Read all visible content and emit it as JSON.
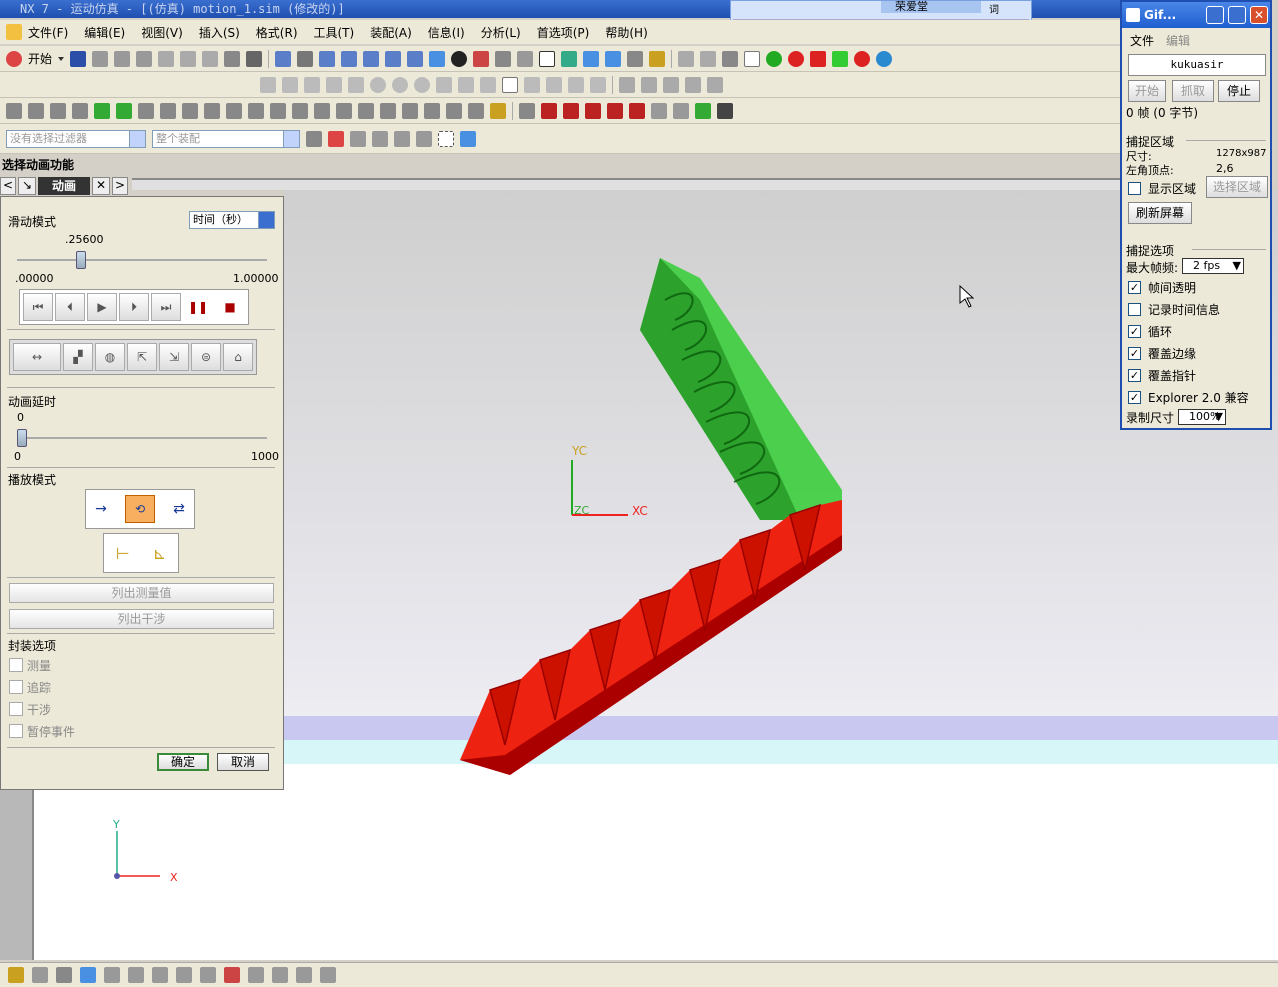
{
  "window": {
    "title": "NX 7 - 运动仿真 - [(仿真) motion_1.sim (修改的)]"
  },
  "menu": [
    "文件(F)",
    "编辑(E)",
    "视图(V)",
    "插入(S)",
    "格式(R)",
    "工具(T)",
    "装配(A)",
    "信息(I)",
    "分析(L)",
    "首选项(P)",
    "帮助(H)"
  ],
  "toolbar": {
    "start_label": "开始",
    "filter_placeholder": "没有选择过滤器",
    "assembly_placeholder": "整个装配"
  },
  "float_window": {
    "label": "荣爱堂",
    "btn1": "词"
  },
  "resource_bar": {
    "title": "选择动画功能",
    "tab_label": "动画"
  },
  "dialog": {
    "slider_mode_label": "滑动模式",
    "slider_mode_value": "时间（秒）",
    "time_value": ".25600",
    "time_min": ".00000",
    "time_max": "1.00000",
    "time_fraction": 0.256,
    "delay_label": "动画延时",
    "delay_value": "0",
    "delay_min": "0",
    "delay_max": "1000",
    "play_mode_label": "播放模式",
    "list_measure": "列出测量值",
    "list_interference": "列出干涉",
    "package_label": "封装选项",
    "package_options": [
      "测量",
      "追踪",
      "干涉",
      "暂停事件"
    ],
    "ok": "确定",
    "cancel": "取消"
  },
  "viewport": {
    "yc": "YC",
    "xc": "XC",
    "zc": "ZC",
    "y": "Y",
    "x": "X"
  },
  "gif": {
    "title": "Gif...",
    "menu_file": "文件",
    "menu_edit": "编辑",
    "author": "kukuasir",
    "btn_start": "开始",
    "btn_capture": "抓取",
    "btn_stop": "停止",
    "frames": "0 帧 (0 字节)",
    "capture_area_label": "捕捉区域",
    "size_label": "尺寸:",
    "size_value": "1278x987",
    "corner_label": "左角顶点:",
    "corner_value": "2,6",
    "show_area": "显示区域",
    "select_area": "选择区域",
    "refresh": "刷新屏幕",
    "capture_options_label": "捕捉选项",
    "max_fps_label": "最大帧频:",
    "max_fps_value": "2 fps",
    "options": [
      {
        "label": "帧间透明",
        "checked": true
      },
      {
        "label": "记录时间信息",
        "checked": false
      },
      {
        "label": "循环",
        "checked": true
      },
      {
        "label": "覆盖边缘",
        "checked": true
      },
      {
        "label": "覆盖指针",
        "checked": true
      },
      {
        "label": "Explorer 2.0 兼容",
        "checked": true
      }
    ],
    "record_size_label": "录制尺寸",
    "record_size_value": "100%"
  }
}
